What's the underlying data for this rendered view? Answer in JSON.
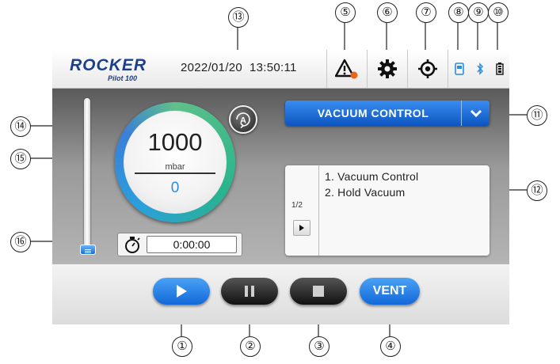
{
  "header": {
    "logo_text": "ROCKER",
    "logo_sub": "Pilot 100",
    "date": "2022/01/20",
    "time": "13:50:11",
    "icons": [
      "warning-icon",
      "settings-gear-icon",
      "target-icon",
      "sd-card-icon",
      "bluetooth-icon",
      "battery-icon"
    ]
  },
  "gauge": {
    "value": "1000",
    "unit": "mbar",
    "sub_value": "0"
  },
  "auto_button": {
    "label": "A"
  },
  "timer": {
    "value": "0:00:00"
  },
  "mode_dropdown": {
    "label": "VACUUM CONTROL"
  },
  "program_list": {
    "page": "1/2",
    "items": [
      "1. Vacuum Control",
      "2. Hold Vacuum"
    ]
  },
  "controls": {
    "vent_label": "VENT"
  },
  "callouts": [
    "①",
    "②",
    "③",
    "④",
    "⑤",
    "⑥",
    "⑦",
    "⑧",
    "⑨",
    "⑩",
    "⑪",
    "⑫",
    "⑬",
    "⑭",
    "⑮",
    "⑯"
  ],
  "colors": {
    "accent_blue": "#1a6fd8",
    "warning_dot": "#e8661c",
    "logo_blue": "#1b3f8c"
  }
}
